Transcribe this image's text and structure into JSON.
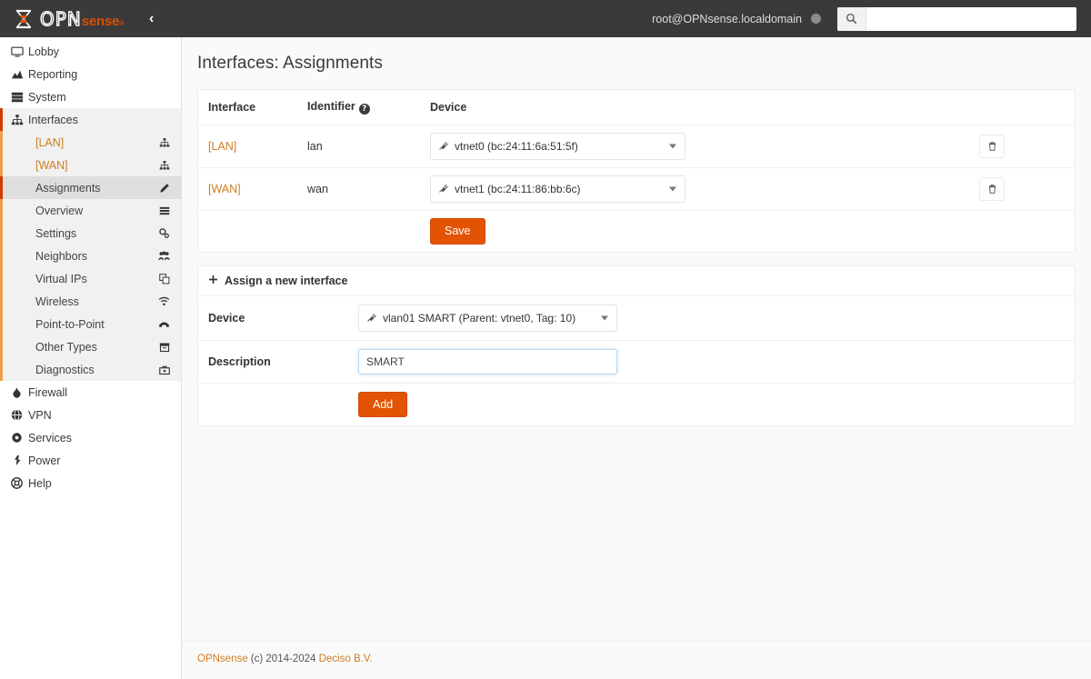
{
  "header": {
    "brand_opn": "OPN",
    "brand_sense": "sense",
    "brand_reg": "®",
    "collapse_icon": "chevron-left-icon",
    "collapse_glyph": "‹",
    "user": "root@OPNsense.localdomain",
    "search_placeholder": "",
    "search_value": ""
  },
  "sidebar": {
    "items": [
      {
        "label": "Lobby",
        "icon": "monitor-icon",
        "glyph": "⎕"
      },
      {
        "label": "Reporting",
        "icon": "chart-area-icon",
        "glyph": "◢"
      },
      {
        "label": "System",
        "icon": "server-icon",
        "glyph": "☰"
      },
      {
        "label": "Interfaces",
        "icon": "sitemap-icon",
        "glyph": "⛓"
      },
      {
        "label": "Firewall",
        "icon": "fire-icon",
        "glyph": "☲"
      },
      {
        "label": "VPN",
        "icon": "globe-icon",
        "glyph": "◔"
      },
      {
        "label": "Services",
        "icon": "gear-icon",
        "glyph": "⚙"
      },
      {
        "label": "Power",
        "icon": "plug-icon",
        "glyph": "⚡"
      },
      {
        "label": "Help",
        "icon": "life-ring-icon",
        "glyph": "⊕"
      }
    ],
    "interfaces_sub": [
      {
        "label": "[LAN]",
        "icon": "sitemap-icon",
        "active": false,
        "orange": true
      },
      {
        "label": "[WAN]",
        "icon": "sitemap-icon",
        "active": false,
        "orange": true
      },
      {
        "label": "Assignments",
        "icon": "pencil-icon",
        "active": true,
        "orange": false
      },
      {
        "label": "Overview",
        "icon": "list-icon",
        "active": false,
        "orange": false
      },
      {
        "label": "Settings",
        "icon": "gears-icon",
        "active": false,
        "orange": false
      },
      {
        "label": "Neighbors",
        "icon": "users-icon",
        "active": false,
        "orange": false
      },
      {
        "label": "Virtual IPs",
        "icon": "clone-icon",
        "active": false,
        "orange": false
      },
      {
        "label": "Wireless",
        "icon": "wifi-icon",
        "active": false,
        "orange": false
      },
      {
        "label": "Point-to-Point",
        "icon": "phone-icon",
        "active": false,
        "orange": false
      },
      {
        "label": "Other Types",
        "icon": "archive-icon",
        "active": false,
        "orange": false
      },
      {
        "label": "Diagnostics",
        "icon": "toolbox-icon",
        "active": false,
        "orange": false
      }
    ]
  },
  "page": {
    "title": "Interfaces: Assignments"
  },
  "assignments_table": {
    "headers": {
      "interface": "Interface",
      "identifier": "Identifier",
      "identifier_help_icon": "question-circle-icon",
      "device": "Device"
    },
    "rows": [
      {
        "interface": "[LAN]",
        "identifier": "lan",
        "device": "vtnet0 (bc:24:11:6a:51:5f)",
        "device_icon": "plug-icon",
        "delete_icon": "trash-icon"
      },
      {
        "interface": "[WAN]",
        "identifier": "wan",
        "device": "vtnet1 (bc:24:11:86:bb:6c)",
        "device_icon": "plug-icon",
        "delete_icon": "trash-icon"
      }
    ],
    "save_label": "Save"
  },
  "assign_new": {
    "title": "Assign a new interface",
    "title_icon": "plus-icon",
    "device_label": "Device",
    "device_value": "vlan01 SMART (Parent: vtnet0, Tag: 10)",
    "device_icon": "plug-icon",
    "description_label": "Description",
    "description_value": "SMART",
    "description_placeholder": "",
    "add_label": "Add"
  },
  "footer": {
    "brand": "OPNsense",
    "copy": " (c) 2014-2024 ",
    "company": "Deciso B.V."
  },
  "colors": {
    "accent": "#e25303",
    "link": "#d07c20",
    "topbar": "#3a3a3a",
    "sidebar_active": "#dedede",
    "sub_border": "#eda04a",
    "active_border": "#cf3b00"
  }
}
